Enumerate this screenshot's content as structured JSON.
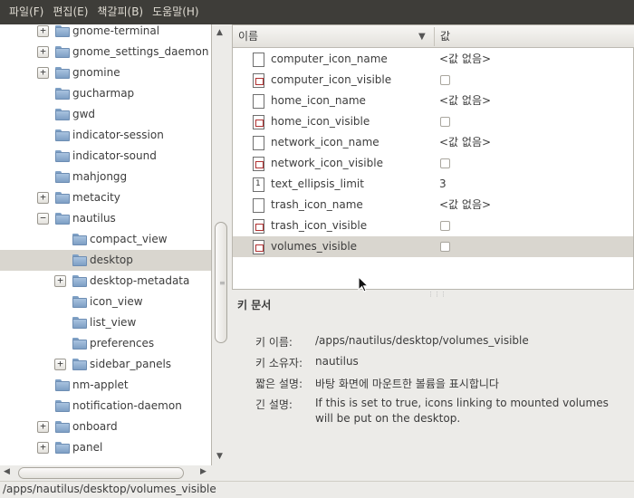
{
  "menubar": {
    "items": [
      "파일(F)",
      "편집(E)",
      "책갈피(B)",
      "도움말(H)"
    ]
  },
  "tree": {
    "items": [
      {
        "label": "gnome-terminal",
        "expander": "+",
        "level": 1
      },
      {
        "label": "gnome_settings_daemon",
        "expander": "+",
        "level": 1
      },
      {
        "label": "gnomine",
        "expander": "+",
        "level": 1
      },
      {
        "label": "gucharmap",
        "expander": "",
        "level": 1
      },
      {
        "label": "gwd",
        "expander": "",
        "level": 1
      },
      {
        "label": "indicator-session",
        "expander": "",
        "level": 1
      },
      {
        "label": "indicator-sound",
        "expander": "",
        "level": 1
      },
      {
        "label": "mahjongg",
        "expander": "",
        "level": 1
      },
      {
        "label": "metacity",
        "expander": "+",
        "level": 1
      },
      {
        "label": "nautilus",
        "expander": "−",
        "level": 1
      },
      {
        "label": "compact_view",
        "expander": "",
        "level": 2
      },
      {
        "label": "desktop",
        "expander": "",
        "level": 2,
        "selected": true
      },
      {
        "label": "desktop-metadata",
        "expander": "+",
        "level": 2
      },
      {
        "label": "icon_view",
        "expander": "",
        "level": 2
      },
      {
        "label": "list_view",
        "expander": "",
        "level": 2
      },
      {
        "label": "preferences",
        "expander": "",
        "level": 2
      },
      {
        "label": "sidebar_panels",
        "expander": "+",
        "level": 2
      },
      {
        "label": "nm-applet",
        "expander": "",
        "level": 1
      },
      {
        "label": "notification-daemon",
        "expander": "",
        "level": 1
      },
      {
        "label": "onboard",
        "expander": "+",
        "level": 1
      },
      {
        "label": "panel",
        "expander": "+",
        "level": 1
      }
    ]
  },
  "list": {
    "columns": {
      "name": "이름",
      "value": "값"
    },
    "rows": [
      {
        "name": "computer_icon_name",
        "icon": "file",
        "value": "<값 없음>"
      },
      {
        "name": "computer_icon_visible",
        "icon": "check",
        "value": ""
      },
      {
        "name": "home_icon_name",
        "icon": "file",
        "value": "<값 없음>"
      },
      {
        "name": "home_icon_visible",
        "icon": "check",
        "value": ""
      },
      {
        "name": "network_icon_name",
        "icon": "file",
        "value": "<값 없음>"
      },
      {
        "name": "network_icon_visible",
        "icon": "check",
        "value": ""
      },
      {
        "name": "text_ellipsis_limit",
        "icon": "number",
        "icon_text": "1",
        "value": "3"
      },
      {
        "name": "trash_icon_name",
        "icon": "file",
        "value": "<값 없음>"
      },
      {
        "name": "trash_icon_visible",
        "icon": "check",
        "value": ""
      },
      {
        "name": "volumes_visible",
        "icon": "check",
        "value": "",
        "selected": true
      }
    ]
  },
  "doc": {
    "title": "키 문서",
    "key_name_label": "키 이름:",
    "key_name": "/apps/nautilus/desktop/volumes_visible",
    "owner_label": "키 소유자:",
    "owner": "nautilus",
    "short_label": "짧은 설명:",
    "short_desc": "바탕 화면에 마운트한 볼륨을 표시합니다",
    "long_label": "긴 설명:",
    "long_desc": "If this is set to true, icons linking to mounted volumes will be put on the desktop."
  },
  "statusbar": {
    "path": "/apps/nautilus/desktop/volumes_visible"
  },
  "colors": {
    "menubar_bg": "#3e3d39",
    "selection_bg": "#d9d6cf",
    "folder": "#7e9fc4"
  },
  "icons": {
    "folder": "folder-icon",
    "file": "file-icon",
    "check": "checkbox-key-icon",
    "number": "integer-key-icon"
  }
}
